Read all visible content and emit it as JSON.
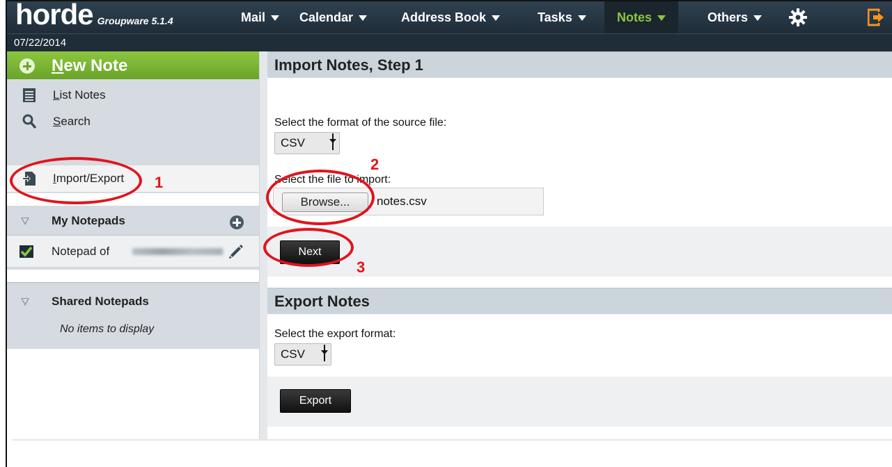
{
  "app": {
    "logo_text": "horde",
    "logo_subtitle": "Groupware 5.1.4"
  },
  "menu": {
    "mail": "Mail",
    "calendar": "Calendar",
    "address_book": "Address Book",
    "tasks": "Tasks",
    "notes": "Notes",
    "others": "Others",
    "icons": [
      "gear-icon",
      "logout-icon"
    ],
    "active_color": "#8cc63f"
  },
  "date": "07/22/2014",
  "sidebar": {
    "new_note": "New Note",
    "links": [
      {
        "label": "List Notes",
        "icon": "list-icon"
      },
      {
        "label": "Search",
        "icon": "search-icon"
      },
      {
        "label": "Import/Export",
        "icon": "import-export-icon",
        "active": true
      }
    ],
    "my_notepads": {
      "title": "My Notepads",
      "items": [
        {
          "label": "Notepad of",
          "checked": true
        }
      ]
    },
    "shared_notepads": {
      "title": "Shared Notepads",
      "empty_text": "No items to display"
    }
  },
  "import": {
    "title": "Import Notes, Step 1",
    "format_label": "Select the format of the source file:",
    "format_value": "CSV",
    "file_label": "Select the file to import:",
    "browse_label": "Browse...",
    "file_name": "notes.csv",
    "next_label": "Next"
  },
  "export": {
    "title": "Export Notes",
    "format_label": "Select the export format:",
    "format_value": "CSV",
    "export_label": "Export"
  },
  "annotations": {
    "one": "1",
    "two": "2",
    "three": "3",
    "color": "#e0141e"
  }
}
